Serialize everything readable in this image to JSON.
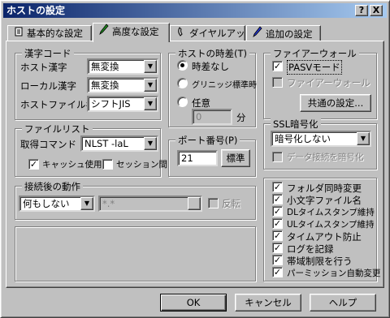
{
  "window": {
    "title": "ホストの設定",
    "help_btn": "?",
    "close_btn": "X"
  },
  "tabs": [
    {
      "label": "基本的な設定",
      "icon": "document-icon"
    },
    {
      "label": "高度な設定",
      "icon": "pen-icon"
    },
    {
      "label": "ダイヤルアップ",
      "icon": "phone-icon"
    },
    {
      "label": "追加の設定",
      "icon": "pencil-icon"
    }
  ],
  "kanji": {
    "title": "漢字コード",
    "host_label": "ホスト漢字",
    "host_value": "無変換",
    "local_label": "ローカル漢字",
    "local_value": "無変換",
    "filename_label": "ホストファイル名",
    "filename_value": "シフトJIS"
  },
  "timezone": {
    "title": "ホストの時差(T)",
    "opt1": "時差なし",
    "opt2": "グリニッジ標準時",
    "opt3": "任意",
    "value": "0",
    "unit": "分"
  },
  "firewall": {
    "title": "ファイアーウォール",
    "pasv": "PASVモード",
    "firewall": "ファイアーウォール",
    "common_btn": "共通の設定..."
  },
  "filelist": {
    "title": "ファイルリスト",
    "cmd_label": "取得コマンド",
    "cmd_value": "NLST -laL",
    "cache": "キャッシュ使用",
    "session": "セッション間"
  },
  "port": {
    "title": "ポート番号(P)",
    "value": "21",
    "std_btn": "標準"
  },
  "ssl": {
    "title": "SSL暗号化",
    "value": "暗号化しない",
    "data_encrypt": "データ接続を暗号化"
  },
  "after_connect": {
    "title": "接続後の動作",
    "action_value": "何もしない",
    "path_value": "*.*",
    "reverse": "反転"
  },
  "options": [
    {
      "label": "フォルダ同時変更",
      "checked": true
    },
    {
      "label": "小文字ファイル名",
      "checked": true
    },
    {
      "label": "DLタイムスタンプ維持",
      "checked": true
    },
    {
      "label": "ULタイムスタンプ維持",
      "checked": true
    },
    {
      "label": "タイムアウト防止",
      "checked": true
    },
    {
      "label": "ログを記録",
      "checked": true
    },
    {
      "label": "帯域制限を行う",
      "checked": true
    },
    {
      "label": "パーミッション自動変更",
      "checked": true
    }
  ],
  "buttons": {
    "ok": "OK",
    "cancel": "キャンセル",
    "help": "ヘルプ"
  }
}
